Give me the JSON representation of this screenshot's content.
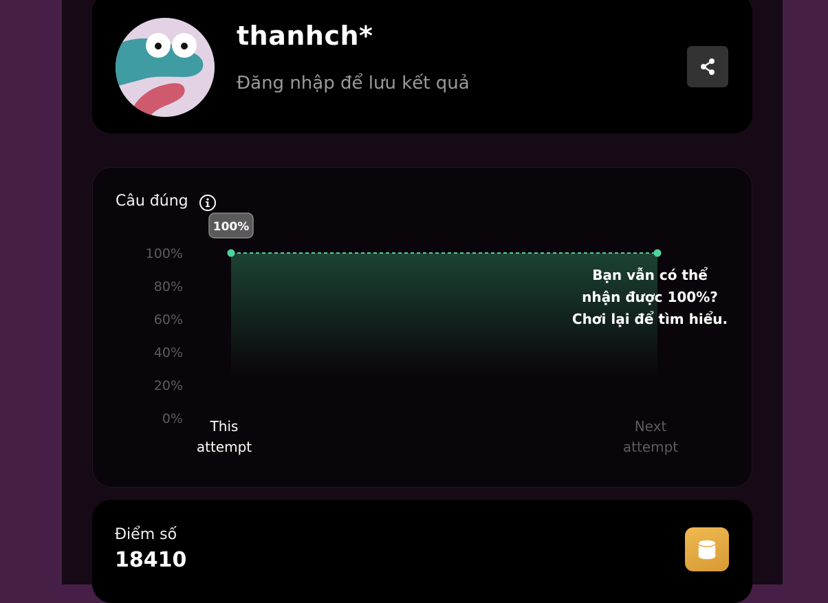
{
  "profile": {
    "username": "thanhch*",
    "login_hint": "Đăng nhập để lưu kết quả",
    "avatar_icon": "avatar-face-icon",
    "share_icon": "share-icon"
  },
  "accuracy_chart": {
    "title": "Câu đúng",
    "info_icon": "info-icon",
    "encourage_lines": [
      "Bạn vẫn có thể",
      "nhận được 100%?",
      "Chơi lại để tìm hiểu."
    ]
  },
  "chart_data": {
    "type": "area",
    "categories": [
      "This attempt",
      "Next attempt"
    ],
    "category_lines": [
      [
        "This",
        "attempt"
      ],
      [
        "Next",
        "attempt"
      ]
    ],
    "values": [
      100,
      100
    ],
    "data_labels": [
      "100%"
    ],
    "y_ticks": [
      "100%",
      "80%",
      "60%",
      "40%",
      "20%",
      "0%"
    ],
    "ylim": [
      0,
      100
    ],
    "line_style": "dashed",
    "line_color": "#4fd39a",
    "area_color": "#1e4a38",
    "grid": false,
    "legend": "none"
  },
  "score": {
    "label": "Điểm số",
    "value": "18410",
    "icon": "coins-icon"
  },
  "colors": {
    "page_background": "#461f46",
    "column_background": "#150a15",
    "card_background": "#000000",
    "accent_green": "#4fd39a",
    "coin_gold": "#e5a942"
  }
}
